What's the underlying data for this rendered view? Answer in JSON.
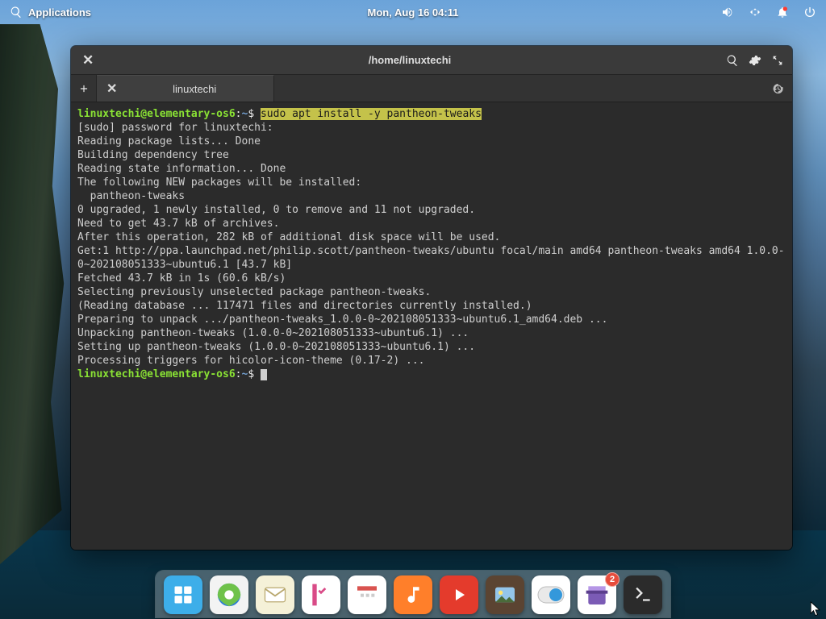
{
  "topbar": {
    "apps_label": "Applications",
    "clock": "Mon, Aug 16    04:11"
  },
  "window": {
    "title": "/home/linuxtechi",
    "tab_label": "linuxtechi"
  },
  "terminal": {
    "user": "linuxtechi@elementary-os6",
    "sep": ":",
    "path": "~",
    "sigil": "$",
    "command": "sudo apt install -y pantheon-tweaks",
    "lines": [
      "[sudo] password for linuxtechi: ",
      "Reading package lists... Done",
      "Building dependency tree       ",
      "Reading state information... Done",
      "The following NEW packages will be installed:",
      "  pantheon-tweaks",
      "0 upgraded, 1 newly installed, 0 to remove and 11 not upgraded.",
      "Need to get 43.7 kB of archives.",
      "After this operation, 282 kB of additional disk space will be used.",
      "Get:1 http://ppa.launchpad.net/philip.scott/pantheon-tweaks/ubuntu focal/main amd64 pantheon-tweaks amd64 1.0.0-0~202108051333~ubuntu6.1 [43.7 kB]",
      "Fetched 43.7 kB in 1s (60.6 kB/s)     ",
      "Selecting previously unselected package pantheon-tweaks.",
      "(Reading database ... 117471 files and directories currently installed.)",
      "Preparing to unpack .../pantheon-tweaks_1.0.0-0~202108051333~ubuntu6.1_amd64.deb ...",
      "Unpacking pantheon-tweaks (1.0.0-0~202108051333~ubuntu6.1) ...",
      "Setting up pantheon-tweaks (1.0.0-0~202108051333~ubuntu6.1) ...",
      "Processing triggers for hicolor-icon-theme (0.17-2) ..."
    ]
  },
  "dock": {
    "items": [
      {
        "name": "multitasking",
        "bg": "#3daee9"
      },
      {
        "name": "web-browser",
        "bg": "#f3f3f3"
      },
      {
        "name": "mail",
        "bg": "#f5f1d8"
      },
      {
        "name": "tasks",
        "bg": "#ffffff"
      },
      {
        "name": "calendar",
        "bg": "#ffffff"
      },
      {
        "name": "music",
        "bg": "#ff7f2a"
      },
      {
        "name": "videos",
        "bg": "#e43b2c"
      },
      {
        "name": "photos",
        "bg": "#5b4432"
      },
      {
        "name": "settings",
        "bg": "#ffffff"
      },
      {
        "name": "appcenter",
        "bg": "#ffffff",
        "badge": "2"
      },
      {
        "name": "terminal",
        "bg": "#2b2b2b"
      }
    ]
  }
}
